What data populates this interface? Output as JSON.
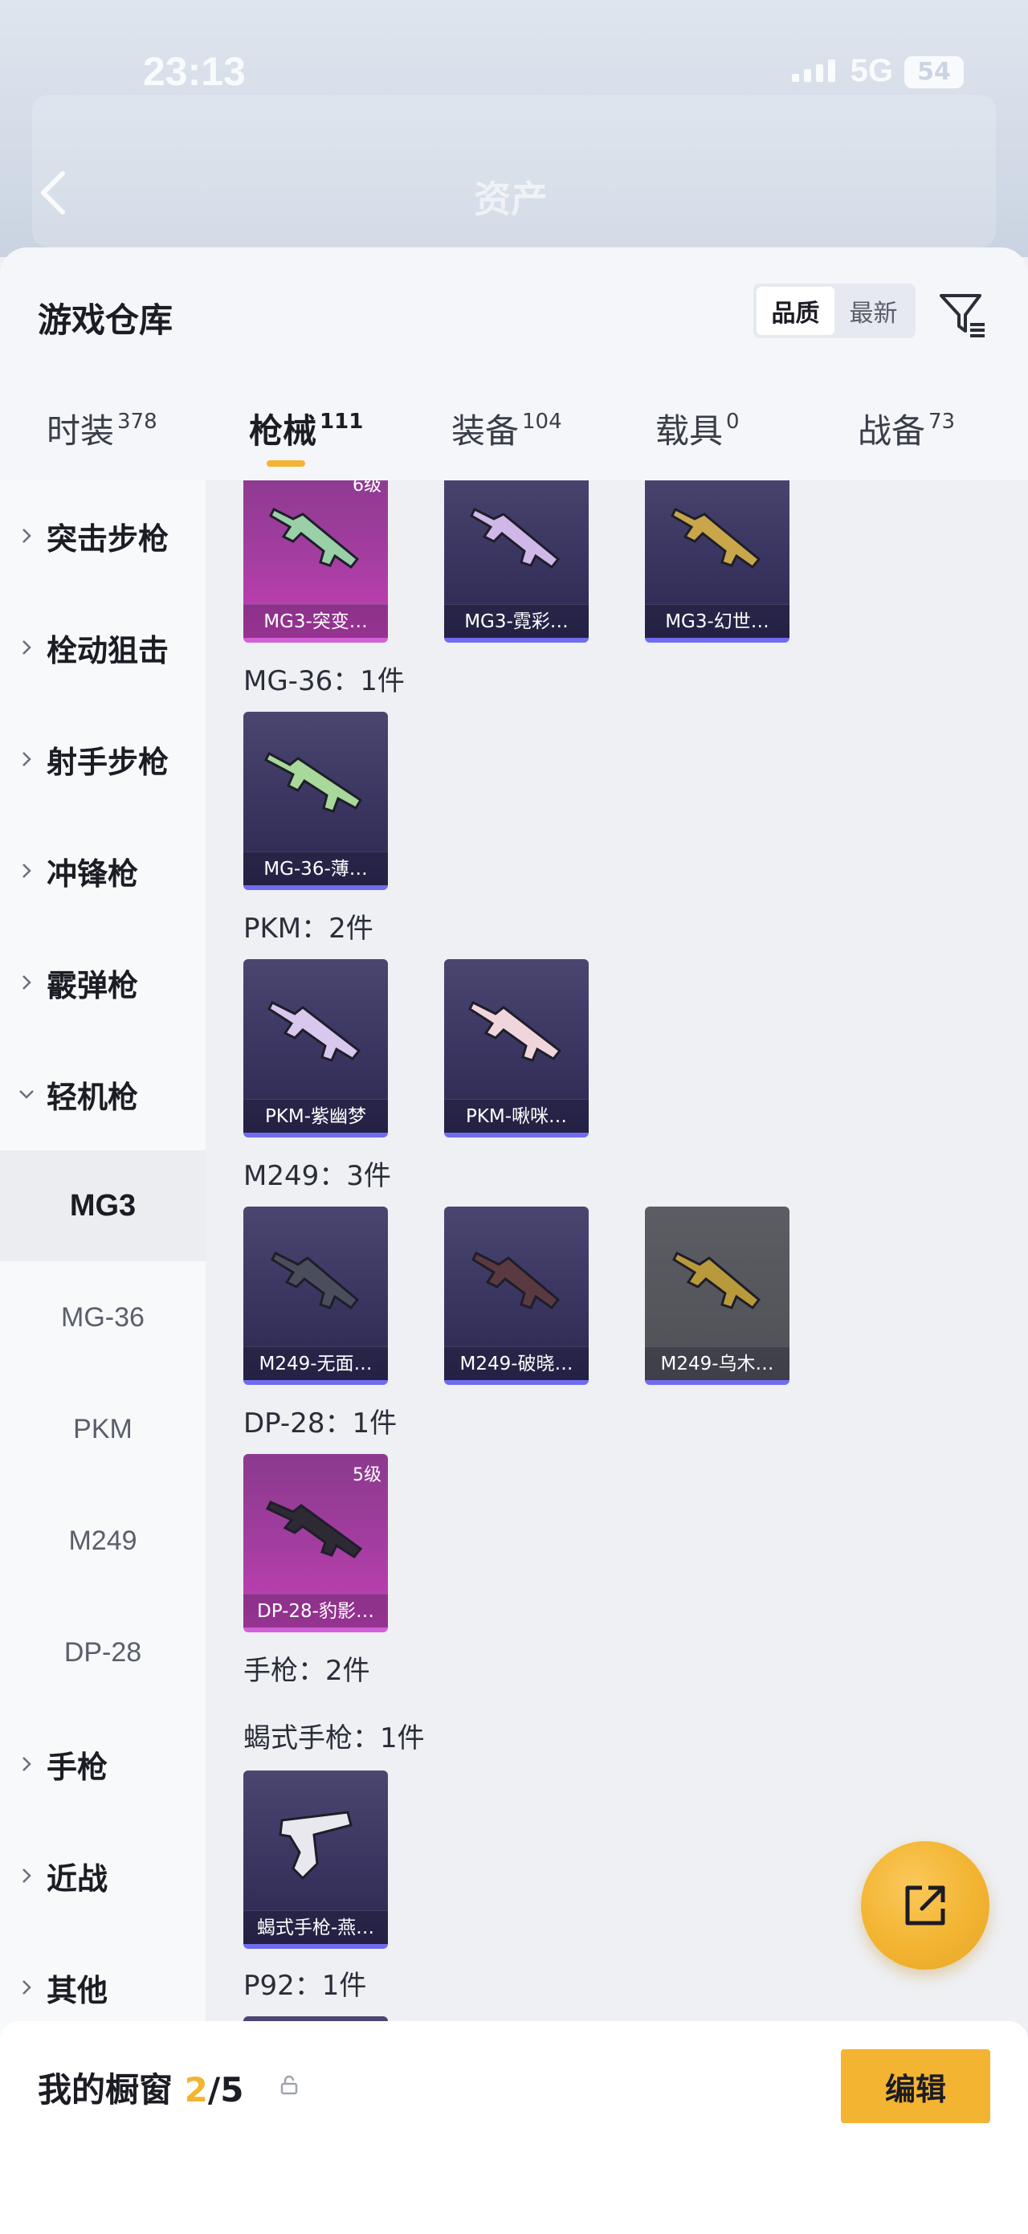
{
  "status_bar": {
    "time": "23:13",
    "network": "5G",
    "battery": "54"
  },
  "header": {
    "title": "资产"
  },
  "sheet": {
    "title": "游戏仓库",
    "sort_options": [
      "品质",
      "最新"
    ],
    "tabs": [
      {
        "label": "时装",
        "count": "378"
      },
      {
        "label": "枪械",
        "count": "111"
      },
      {
        "label": "装备",
        "count": "104"
      },
      {
        "label": "载具",
        "count": "0"
      },
      {
        "label": "战备",
        "count": "73"
      }
    ]
  },
  "sidebar": {
    "categories": [
      {
        "label": "突击步枪"
      },
      {
        "label": "栓动狙击"
      },
      {
        "label": "射手步枪"
      },
      {
        "label": "冲锋枪"
      },
      {
        "label": "霰弹枪"
      },
      {
        "label": "轻机枪"
      }
    ],
    "subitems": [
      "MG3",
      "MG-36",
      "PKM",
      "M249",
      "DP-28"
    ],
    "more_categories": [
      {
        "label": "手枪"
      },
      {
        "label": "近战"
      },
      {
        "label": "其他"
      }
    ]
  },
  "groups": {
    "mg3": {
      "cards": [
        {
          "name": "MG3-突变…",
          "level": "6级"
        },
        {
          "name": "MG3-霓彩…"
        },
        {
          "name": "MG3-幻世…"
        }
      ]
    },
    "mg36": {
      "title": "MG-36：1件",
      "cards": [
        {
          "name": "MG-36-薄…"
        }
      ]
    },
    "pkm": {
      "title": "PKM：2件",
      "cards": [
        {
          "name": "PKM-紫幽梦"
        },
        {
          "name": "PKM-啾咪…"
        }
      ]
    },
    "m249": {
      "title": "M249：3件",
      "cards": [
        {
          "name": "M249-无面…"
        },
        {
          "name": "M249-破晓…"
        },
        {
          "name": "M249-乌木…"
        }
      ]
    },
    "dp28": {
      "title": "DP-28：1件",
      "cards": [
        {
          "name": "DP-28-豹影…",
          "level": "5级"
        }
      ]
    },
    "pistol": {
      "title": "手枪：2件"
    },
    "scorpion": {
      "title": "蝎式手枪：1件",
      "cards": [
        {
          "name": "蝎式手枪-燕…"
        }
      ]
    },
    "p92": {
      "title": "P92：1件"
    }
  },
  "bottom_bar": {
    "label": "我的橱窗",
    "current": "2",
    "total": "/5",
    "edit_label": "编辑"
  },
  "colors": {
    "accent": "#f2b431",
    "purple_quality": "#6f6cf0",
    "pink_quality": "#c540b7"
  }
}
